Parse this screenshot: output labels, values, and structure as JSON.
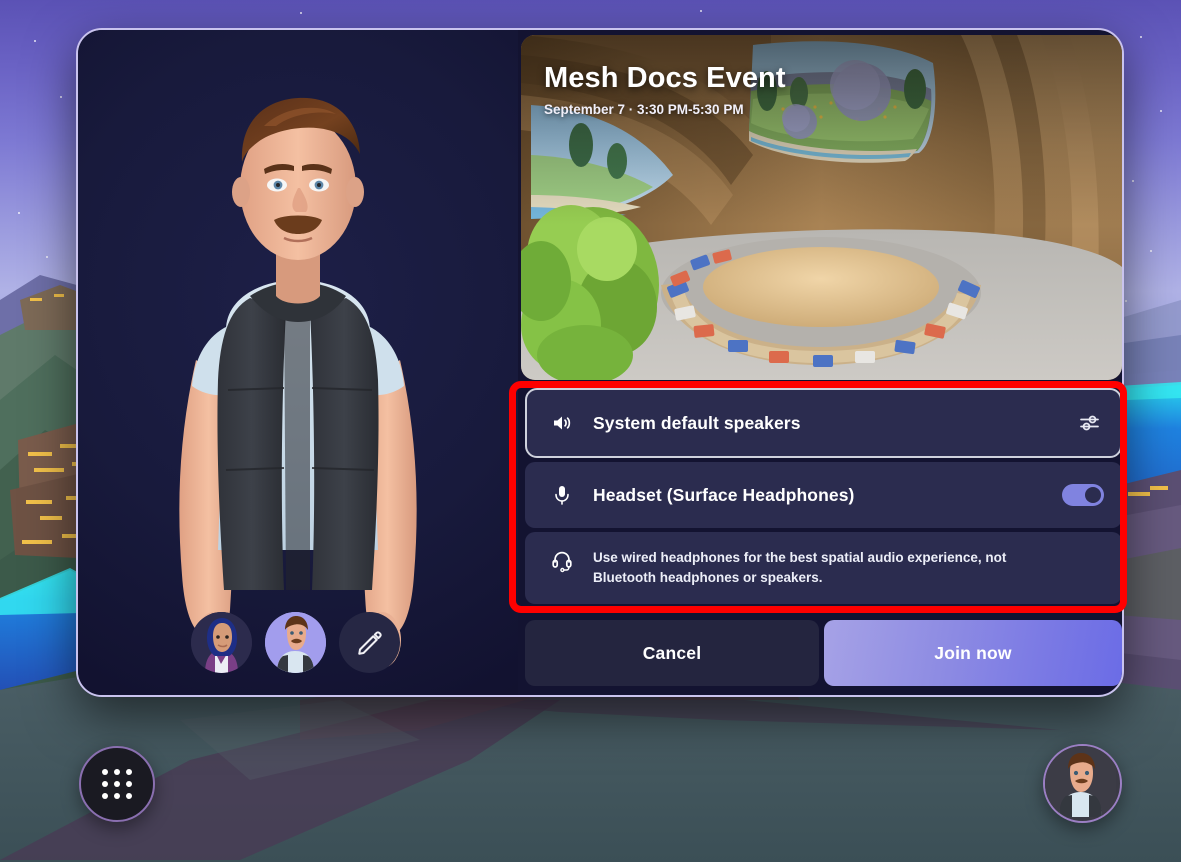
{
  "event": {
    "title": "Mesh Docs Event",
    "datetime": "September 7 · 3:30 PM-5:30 PM"
  },
  "audio": {
    "speaker": {
      "label": "System default speakers",
      "icon": "speaker-icon",
      "settings_icon": "sliders-icon",
      "focused": true
    },
    "microphone": {
      "label": "Headset (Surface Headphones)",
      "icon": "microphone-icon",
      "toggle_on": true
    },
    "hint": {
      "icon": "headset-icon",
      "text": "Use wired headphones for the best spatial audio experience, not Bluetooth headphones or speakers."
    }
  },
  "actions": {
    "cancel_label": "Cancel",
    "join_label": "Join now"
  },
  "avatar_picker": {
    "items": [
      {
        "name": "avatar-option-1",
        "selected": false
      },
      {
        "name": "avatar-option-2",
        "selected": true
      }
    ],
    "edit_label": "edit-avatar",
    "edit_icon": "pencil-icon"
  },
  "hud": {
    "app_launcher_icon": "grid-dots-icon",
    "profile_icon": "user-avatar"
  },
  "colors": {
    "accent": "#7b7ae4",
    "toggle_on": "#8083e0",
    "annotation": "#ff0000",
    "dialog_border": "#c9c3ee",
    "dialog_bg": "#131331",
    "row_bg": "#2b2c4f",
    "cancel_bg": "#24253f"
  }
}
